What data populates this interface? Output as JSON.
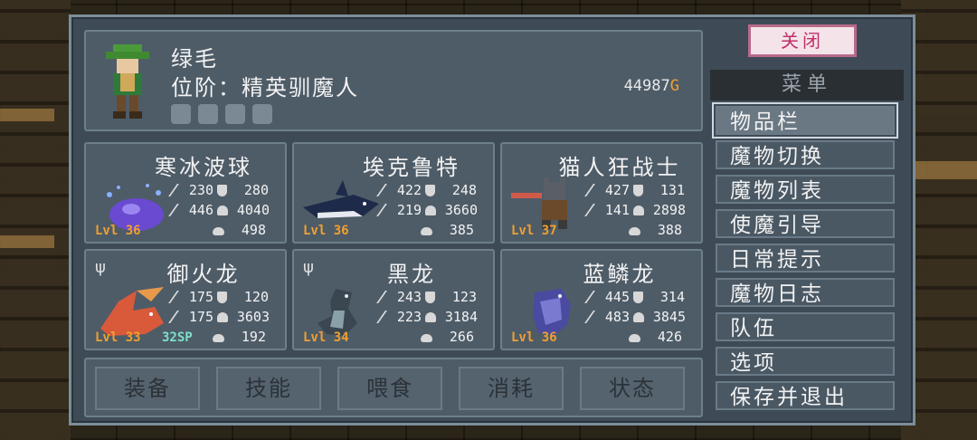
{
  "hero": {
    "name": "绿毛",
    "rank": "位阶：精英驯魔人",
    "gold_amount": "44987",
    "gold_unit": "G"
  },
  "monsters": [
    {
      "name": "寒冰波球",
      "atk": "230",
      "def": "280",
      "mag": "446",
      "hp": "4040",
      "mana": "498",
      "level": "Lvl 36"
    },
    {
      "name": "埃克鲁特",
      "atk": "422",
      "def": "248",
      "mag": "219",
      "hp": "3660",
      "mana": "385",
      "level": "Lvl 36"
    },
    {
      "name": "猫人狂战士",
      "atk": "427",
      "def": "131",
      "mag": "141",
      "hp": "2898",
      "mana": "388",
      "level": "Lvl 37"
    },
    {
      "name": "御火龙",
      "atk": "175",
      "def": "120",
      "mag": "175",
      "hp": "3603",
      "mana": "192",
      "level": "Lvl 33",
      "sp": "32SP"
    },
    {
      "name": "黑龙",
      "atk": "243",
      "def": "123",
      "mag": "223",
      "hp": "3184",
      "mana": "266",
      "level": "Lvl 34"
    },
    {
      "name": "蓝鳞龙",
      "atk": "445",
      "def": "314",
      "mag": "483",
      "hp": "3845",
      "mana": "426",
      "level": "Lvl 36"
    }
  ],
  "tabs": [
    "装备",
    "技能",
    "喂食",
    "消耗",
    "状态"
  ],
  "menu": {
    "close_label": "关闭",
    "title": "菜单",
    "items": [
      "物品栏",
      "魔物切换",
      "魔物列表",
      "使魔引导",
      "日常提示",
      "魔物日志",
      "队伍",
      "选项",
      "保存并退出"
    ]
  },
  "colors": {
    "level": "#f0a030",
    "sp": "#7de0c8",
    "gold_unit": "#f0a030",
    "close_text": "#c0306a"
  }
}
